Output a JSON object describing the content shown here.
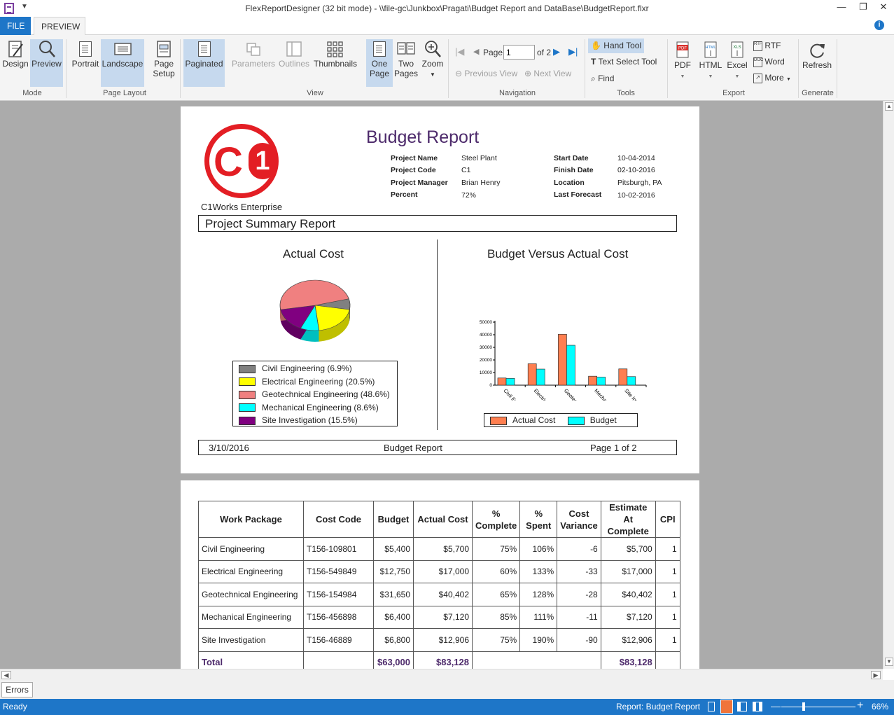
{
  "window": {
    "title": "FlexReportDesigner (32 bit mode) - \\\\file-gc\\Junkbox\\Pragati\\Budget Report and DataBase\\BudgetReport.flxr"
  },
  "tabs": {
    "file": "FILE",
    "preview": "PREVIEW"
  },
  "ribbon": {
    "mode": {
      "label": "Mode",
      "design": "Design",
      "preview": "Preview"
    },
    "layout": {
      "label": "Page Layout",
      "portrait": "Portrait",
      "landscape": "Landscape",
      "setup1": "Page",
      "setup2": "Setup"
    },
    "view": {
      "label": "View",
      "paginated": "Paginated",
      "parameters": "Parameters",
      "outlines": "Outlines",
      "thumbnails": "Thumbnails",
      "one1": "One",
      "one2": "Page",
      "two1": "Two",
      "two2": "Pages",
      "zoom": "Zoom"
    },
    "navigation": {
      "label": "Navigation",
      "page_label": "Page",
      "page_value": "1",
      "of_pages": "of 2",
      "prev_view": "Previous View",
      "next_view": "Next View"
    },
    "tools": {
      "label": "Tools",
      "hand": "Hand Tool",
      "text_select": "Text Select Tool",
      "find": "Find"
    },
    "export": {
      "label": "Export",
      "pdf": "PDF",
      "html": "HTML",
      "excel": "Excel",
      "rtf": "RTF",
      "word": "Word",
      "more": "More"
    },
    "generate": {
      "label": "Generate",
      "refresh": "Refresh"
    }
  },
  "report": {
    "title": "Budget Report",
    "company": "C1Works Enterprise",
    "logo_text": "C1",
    "info_left": [
      {
        "k": "Project Name",
        "v": "Steel Plant"
      },
      {
        "k": "Project Code",
        "v": "C1"
      },
      {
        "k": "Project Manager",
        "v": "Brian Henry"
      },
      {
        "k": "Percent",
        "v": "72%"
      }
    ],
    "info_right": [
      {
        "k": "Start Date",
        "v": "10-04-2014"
      },
      {
        "k": "Finish Date",
        "v": "02-10-2016"
      },
      {
        "k": "Location",
        "v": "Pitsburgh, PA"
      },
      {
        "k": "Last Forecast",
        "v": "10-02-2016"
      }
    ],
    "summary_header": "Project Summary Report",
    "footer": {
      "date": "3/10/2016",
      "name": "Budget Report",
      "page": "Page 1 of 2"
    },
    "table": {
      "headers": [
        "Work Package",
        "Cost Code",
        "Budget",
        "Actual Cost",
        "% Complete",
        "% Spent",
        "Cost Variance",
        "Estimate At Complete",
        "CPI"
      ],
      "rows": [
        [
          "Civil Engineering",
          "T156-109801",
          "$5,400",
          "$5,700",
          "75%",
          "106%",
          "-6",
          "$5,700",
          "1"
        ],
        [
          "Electrical Engineering",
          "T156-549849",
          "$12,750",
          "$17,000",
          "60%",
          "133%",
          "-33",
          "$17,000",
          "1"
        ],
        [
          "Geotechnical Engineering",
          "T156-154984",
          "$31,650",
          "$40,402",
          "65%",
          "128%",
          "-28",
          "$40,402",
          "1"
        ],
        [
          "Mechanical Engineering",
          "T156-456898",
          "$6,400",
          "$7,120",
          "85%",
          "111%",
          "-11",
          "$7,120",
          "1"
        ],
        [
          "Site Investigation",
          "T156-46889",
          "$6,800",
          "$12,906",
          "75%",
          "190%",
          "-90",
          "$12,906",
          "1"
        ]
      ],
      "total": {
        "label": "Total",
        "budget": "$63,000",
        "actual": "$83,128",
        "estimate": "$83,128"
      }
    }
  },
  "chart_data": [
    {
      "type": "pie",
      "title": "Actual Cost",
      "categories": [
        "Civil Engineering",
        "Electrical Engineering",
        "Geotechnical Engineering",
        "Mechanical Engineering",
        "Site Investigation"
      ],
      "values": [
        6.9,
        20.5,
        48.6,
        8.6,
        15.5
      ],
      "legend_labels": [
        "Civil Engineering (6.9%)",
        "Electrical Engineering (20.5%)",
        "Geotechnical Engineering (48.6%)",
        "Mechanical Engineering (8.6%)",
        "Site Investigation (15.5%)"
      ],
      "colors": [
        "#808080",
        "#ffff00",
        "#f08080",
        "#00ffff",
        "#800080"
      ],
      "legend": "bottom"
    },
    {
      "type": "bar",
      "title": "Budget Versus Actual Cost",
      "categories": [
        "Civil Engineering",
        "Electrical Engineering",
        "Geotechnical Engineering",
        "Mechanical Engineering",
        "Site Investigation"
      ],
      "series": [
        {
          "name": "Actual Cost",
          "values": [
            5700,
            17000,
            40402,
            7120,
            12906
          ],
          "color": "#ff7f50"
        },
        {
          "name": "Budget",
          "values": [
            5400,
            12750,
            31650,
            6400,
            6800
          ],
          "color": "#00ffff"
        }
      ],
      "yticks": [
        "0",
        "10000",
        "20000",
        "30000",
        "40000",
        "50000"
      ],
      "ylim": [
        0,
        50000
      ],
      "grid": false,
      "legend": "bottom"
    }
  ],
  "errors_tab": "Errors",
  "status": {
    "ready": "Ready",
    "report": "Report: Budget Report",
    "zoom": "66%"
  }
}
